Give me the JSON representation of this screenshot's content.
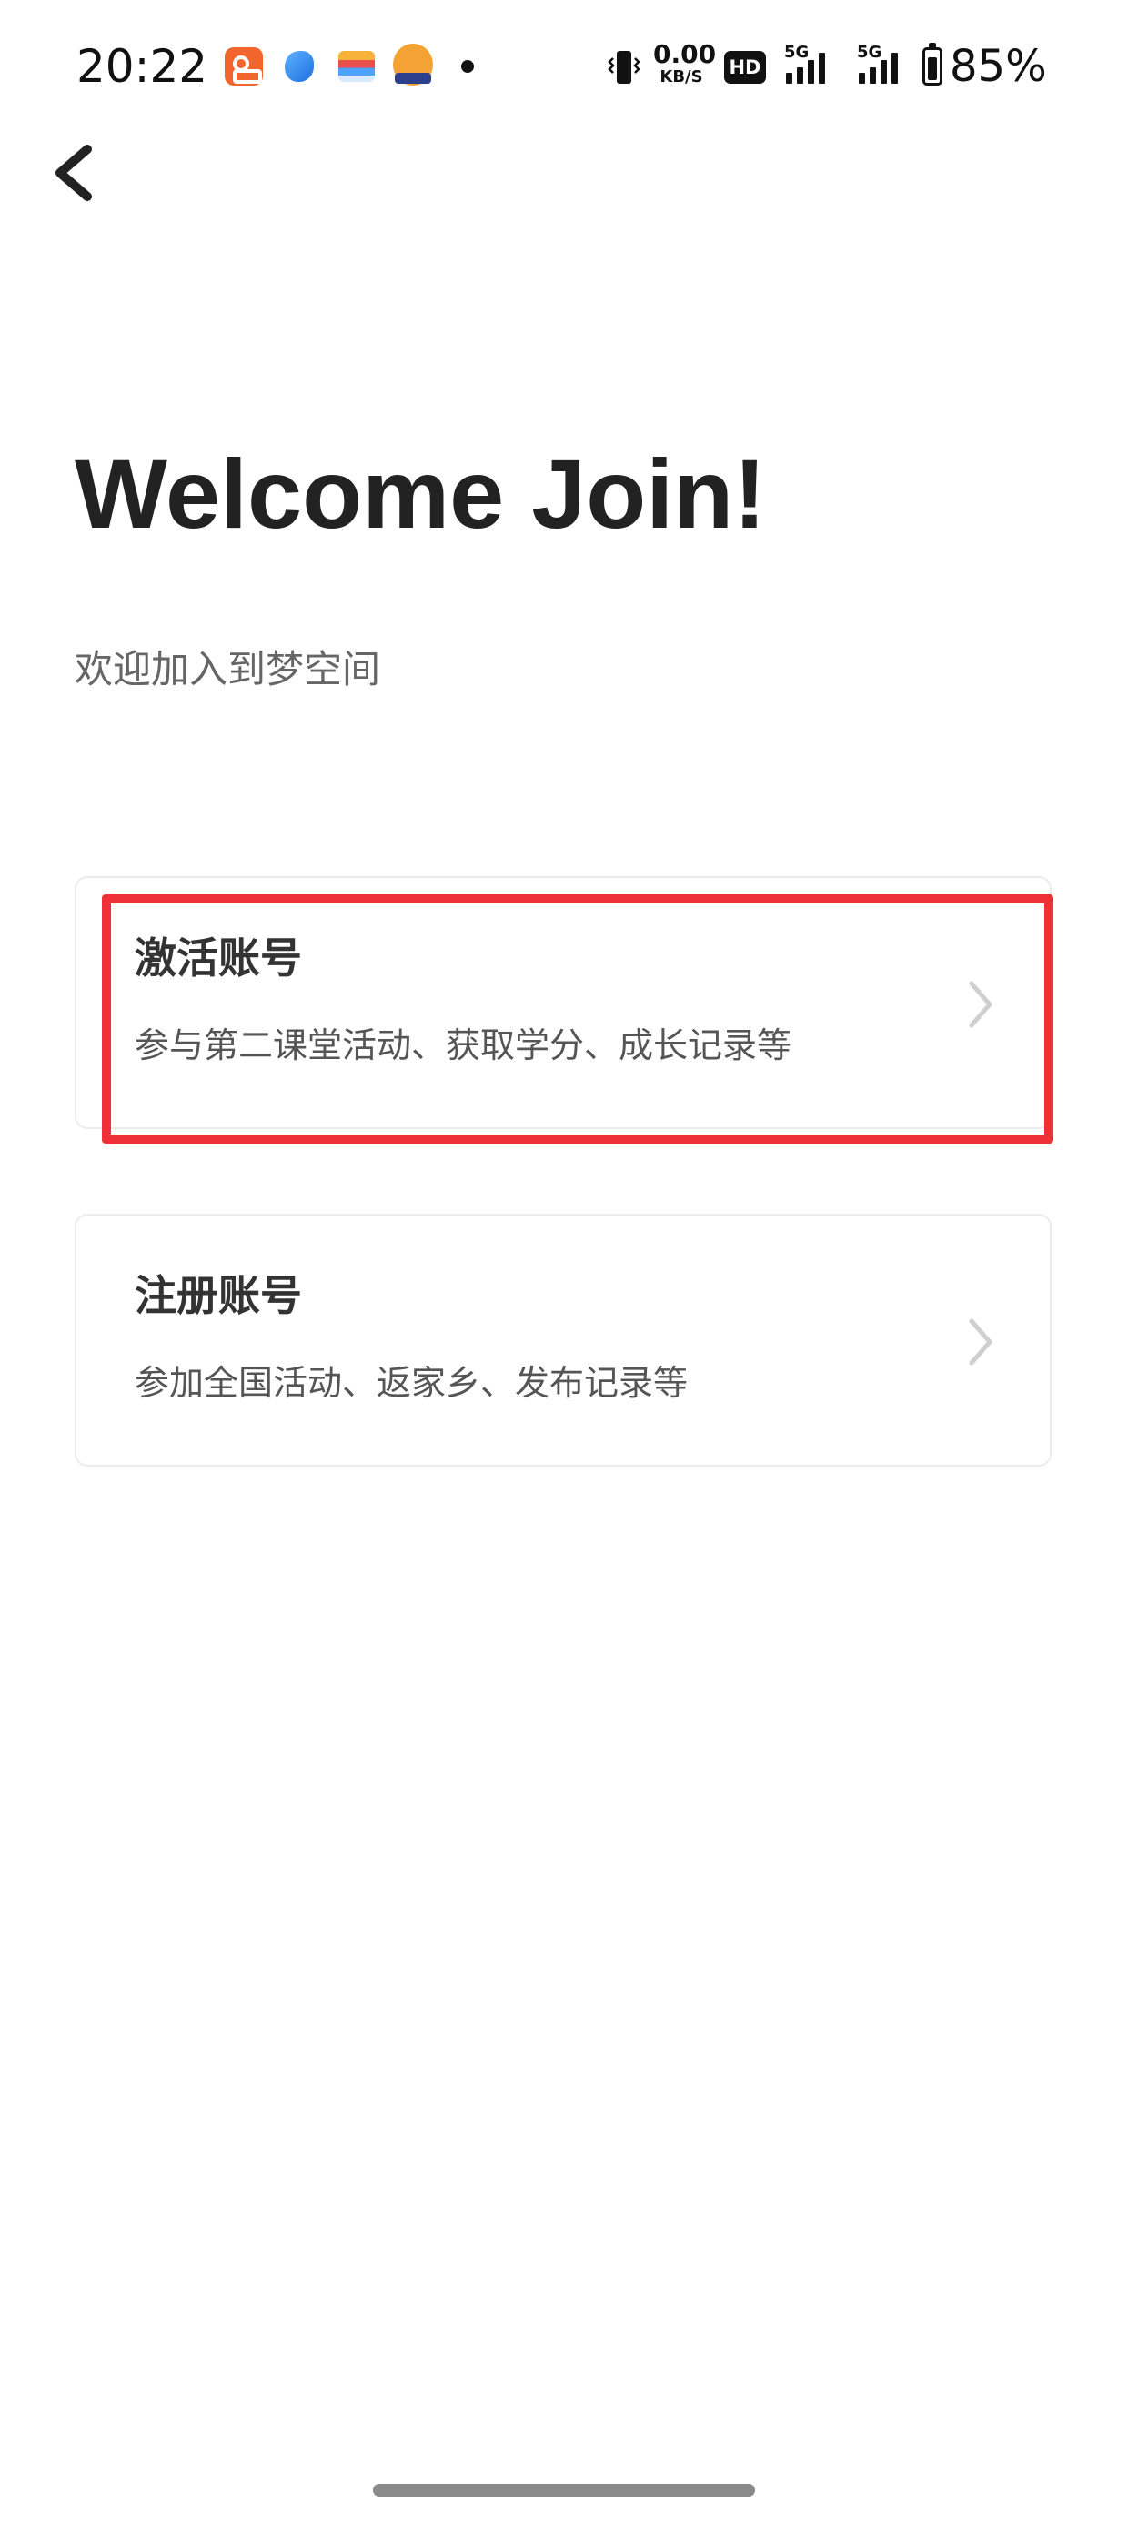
{
  "status_bar": {
    "time": "20:22",
    "app_icons": [
      "kuaishou-app-icon",
      "blue-app-icon",
      "wallet-app-icon",
      "mascot-app-icon"
    ],
    "net_speed_value": "0.00",
    "net_speed_unit": "KB/S",
    "hd_label": "HD",
    "sim1_type": "5G",
    "sim2_type": "5G",
    "battery_percent": "85%"
  },
  "nav": {
    "back_icon": "chevron-left-icon"
  },
  "header": {
    "title": "Welcome Join!",
    "subtitle": "欢迎加入到梦空间"
  },
  "options": [
    {
      "title": "激活账号",
      "description": "参与第二课堂活动、获取学分、成长记录等",
      "icon": "chevron-right-icon"
    },
    {
      "title": "注册账号",
      "description": "参加全国活动、返家乡、发布记录等",
      "icon": "chevron-right-icon"
    }
  ],
  "colors": {
    "highlight": "#f03038",
    "title_text": "#222222",
    "card_border": "#ececec",
    "chevron": "#cfcfcf"
  }
}
